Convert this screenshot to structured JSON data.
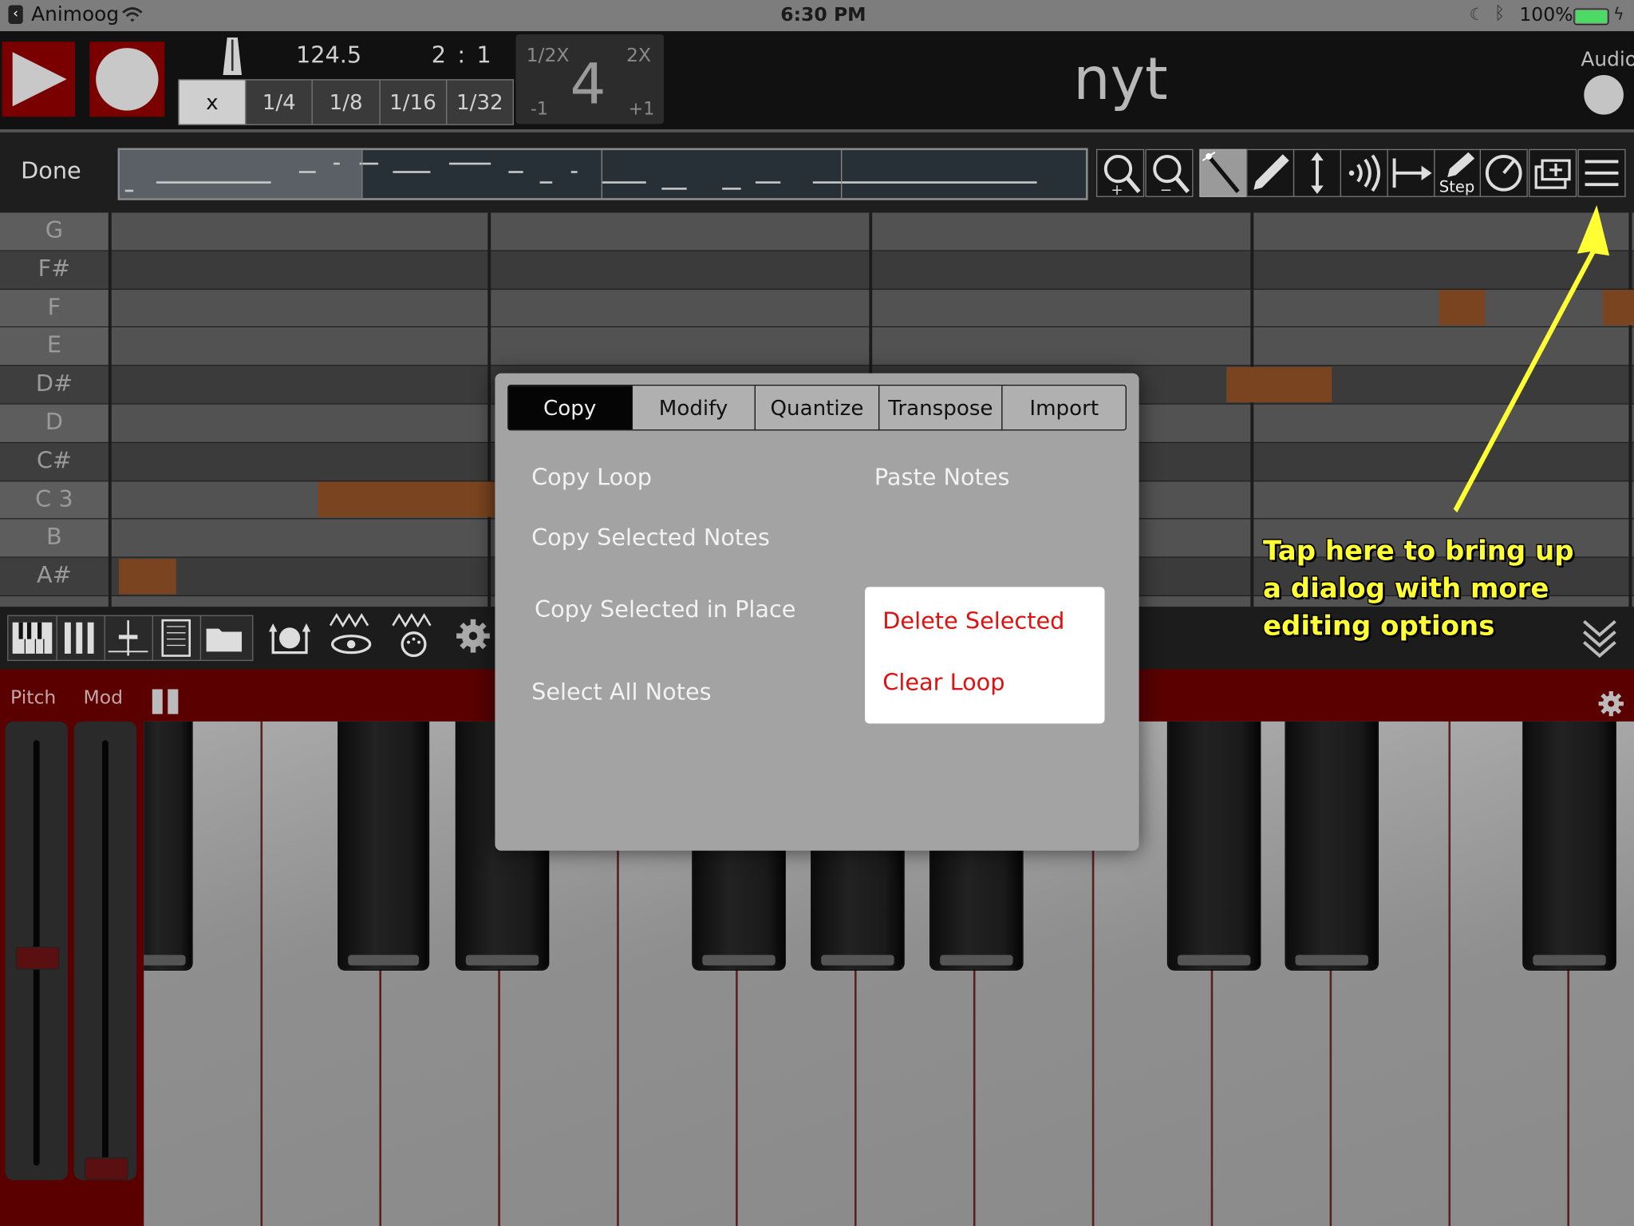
{
  "status_bar": {
    "back_app": "Animoog",
    "time": "6:30 PM",
    "battery": "100%",
    "battery_level": 1.0
  },
  "transport": {
    "tempo": "124.5",
    "signature": "2 : 1",
    "quantize_options": [
      "x",
      "1/4",
      "1/8",
      "1/16",
      "1/32"
    ],
    "quantize_selected": "x",
    "speed": {
      "half": "1/2X",
      "double": "2X",
      "value": "4",
      "minus": "-1",
      "plus": "+1"
    },
    "song_name": "nyt",
    "audio_label": "Audio"
  },
  "editor_toolbar": {
    "done": "Done",
    "tools": [
      {
        "name": "zoom-in-icon"
      },
      {
        "name": "zoom-out-icon"
      },
      {
        "name": "magic-wand-icon",
        "selected": true
      },
      {
        "name": "pencil-icon"
      },
      {
        "name": "vertical-arrows-icon"
      },
      {
        "name": "velocity-icon"
      },
      {
        "name": "length-arrow-icon"
      },
      {
        "name": "step-pencil-icon",
        "label": "Step"
      },
      {
        "name": "dial-icon"
      },
      {
        "name": "add-window-icon"
      },
      {
        "name": "menu-icon"
      }
    ]
  },
  "piano_roll": {
    "notes": [
      "G",
      "F#",
      "F",
      "E",
      "D#",
      "D",
      "C#",
      "C 3",
      "B",
      "A#"
    ]
  },
  "keyboard_panel": {
    "pitch_label": "Pitch",
    "mod_label": "Mod",
    "pitch_value": 0.5,
    "mod_value": 0.0
  },
  "dialog": {
    "tabs": [
      "Copy",
      "Modify",
      "Quantize",
      "Transpose",
      "Import"
    ],
    "active_tab": "Copy",
    "options": {
      "copy_loop": "Copy Loop",
      "paste_notes": "Paste Notes",
      "copy_selected_notes": "Copy Selected Notes",
      "copy_selected_in_place": "Copy Selected in Place",
      "select_all_notes": "Select All Notes",
      "delete_selected": "Delete Selected",
      "clear_loop": "Clear Loop"
    }
  },
  "annotation": {
    "lines": [
      "Tap here to bring up",
      "a dialog with more",
      "editing options"
    ],
    "color": "#ffff33"
  },
  "colors": {
    "transport_red": "#7a0000",
    "note_orange": "#7a4420",
    "danger_red": "#e01010"
  }
}
